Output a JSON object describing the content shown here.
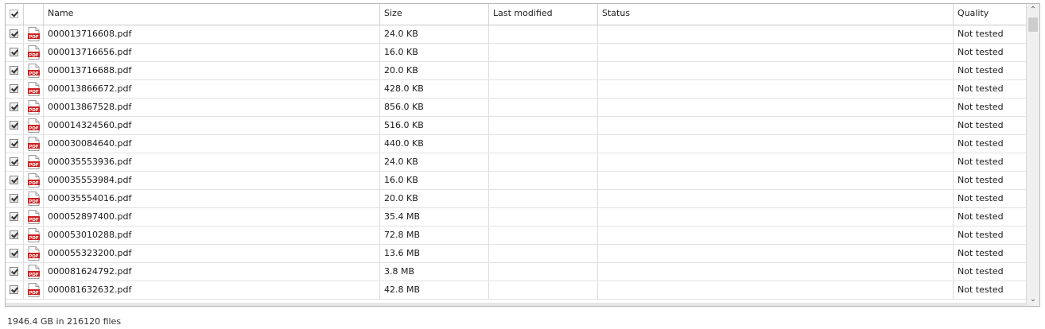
{
  "table": {
    "columns": {
      "name": "Name",
      "size": "Size",
      "last_modified": "Last modified",
      "status": "Status",
      "quality": "Quality"
    },
    "rows": [
      {
        "name": "000013716608.pdf",
        "size": "24.0 KB",
        "last_modified": "",
        "status": "",
        "quality": "Not tested",
        "checked": true
      },
      {
        "name": "000013716656.pdf",
        "size": "16.0 KB",
        "last_modified": "",
        "status": "",
        "quality": "Not tested",
        "checked": true
      },
      {
        "name": "000013716688.pdf",
        "size": "20.0 KB",
        "last_modified": "",
        "status": "",
        "quality": "Not tested",
        "checked": true
      },
      {
        "name": "000013866672.pdf",
        "size": "428.0 KB",
        "last_modified": "",
        "status": "",
        "quality": "Not tested",
        "checked": true
      },
      {
        "name": "000013867528.pdf",
        "size": "856.0 KB",
        "last_modified": "",
        "status": "",
        "quality": "Not tested",
        "checked": true
      },
      {
        "name": "000014324560.pdf",
        "size": "516.0 KB",
        "last_modified": "",
        "status": "",
        "quality": "Not tested",
        "checked": true
      },
      {
        "name": "000030084640.pdf",
        "size": "440.0 KB",
        "last_modified": "",
        "status": "",
        "quality": "Not tested",
        "checked": true
      },
      {
        "name": "000035553936.pdf",
        "size": "24.0 KB",
        "last_modified": "",
        "status": "",
        "quality": "Not tested",
        "checked": true
      },
      {
        "name": "000035553984.pdf",
        "size": "16.0 KB",
        "last_modified": "",
        "status": "",
        "quality": "Not tested",
        "checked": true
      },
      {
        "name": "000035554016.pdf",
        "size": "20.0 KB",
        "last_modified": "",
        "status": "",
        "quality": "Not tested",
        "checked": true
      },
      {
        "name": "000052897400.pdf",
        "size": "35.4 MB",
        "last_modified": "",
        "status": "",
        "quality": "Not tested",
        "checked": true
      },
      {
        "name": "000053010288.pdf",
        "size": "72.8 MB",
        "last_modified": "",
        "status": "",
        "quality": "Not tested",
        "checked": true
      },
      {
        "name": "000055323200.pdf",
        "size": "13.6 MB",
        "last_modified": "",
        "status": "",
        "quality": "Not tested",
        "checked": true
      },
      {
        "name": "000081624792.pdf",
        "size": "3.8 MB",
        "last_modified": "",
        "status": "",
        "quality": "Not tested",
        "checked": true
      },
      {
        "name": "000081632632.pdf",
        "size": "42.8 MB",
        "last_modified": "",
        "status": "",
        "quality": "Not tested",
        "checked": true
      }
    ],
    "file_icon": "pdf-file-icon",
    "checkbox_icon": "checkbox-checked-icon"
  },
  "footer": {
    "summary": "1946.4 GB in 216120 files"
  },
  "colors": {
    "pdf_red": "#cc1f1f",
    "border": "#b8b8b8"
  }
}
